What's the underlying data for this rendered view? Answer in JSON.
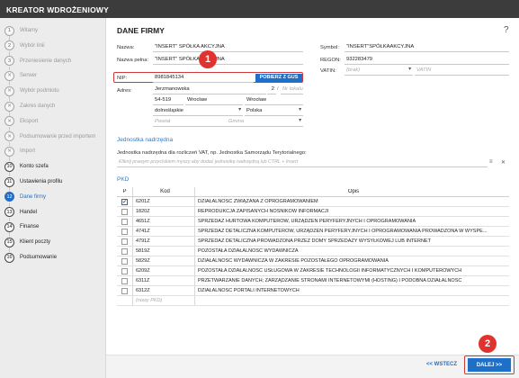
{
  "app": {
    "title": "KREATOR WDROŻENIOWY",
    "help_icon": "?"
  },
  "steps": [
    {
      "num": "1",
      "label": "Witamy",
      "state": "done"
    },
    {
      "num": "2",
      "label": "Wybór linii",
      "state": "done"
    },
    {
      "num": "3",
      "label": "Przeniesienie danych",
      "state": "done"
    },
    {
      "num": "✕",
      "label": "Serwer",
      "state": "skipped"
    },
    {
      "num": "✕",
      "label": "Wybór podmiotu",
      "state": "skipped"
    },
    {
      "num": "✕",
      "label": "Zakres danych",
      "state": "skipped"
    },
    {
      "num": "✕",
      "label": "Eksport",
      "state": "skipped"
    },
    {
      "num": "✕",
      "label": "Podsumowanie przed importem",
      "state": "skipped"
    },
    {
      "num": "✕",
      "label": "Import",
      "state": "skipped"
    },
    {
      "num": "10",
      "label": "Konto szefa",
      "state": "future"
    },
    {
      "num": "11",
      "label": "Ustawienia profilu",
      "state": "future"
    },
    {
      "num": "12",
      "label": "Dane firmy",
      "state": "active"
    },
    {
      "num": "13",
      "label": "Handel",
      "state": "future"
    },
    {
      "num": "14",
      "label": "Finanse",
      "state": "future"
    },
    {
      "num": "15",
      "label": "Klient poczty",
      "state": "future"
    },
    {
      "num": "16",
      "label": "Podsumowanie",
      "state": "future"
    }
  ],
  "form": {
    "heading": "DANE FIRMY",
    "nazwa_label": "Nazwa:",
    "nazwa_value": "\"INSERT\" SPÓŁKA AKCYJNA",
    "nazwa_pelna_label": "Nazwa pełna:",
    "nazwa_pelna_value": "\"INSERT\" SPÓŁKA AKCYJNA",
    "symbol_label": "Symbol:",
    "symbol_value": "\"INSERT\"SPÓŁKAAKCYJNA",
    "regon_label": "REGON:",
    "regon_value": "932283479",
    "vatin_label": "VATIN:",
    "vatin_prefix_placeholder": "(brak)",
    "vatin_placeholder": "VATIN",
    "nip_label": "NIP:",
    "nip_value": "8981845134",
    "gus_button": "POBIERZ Z GUS",
    "adres_label": "Adres:",
    "ulica": "Jerzmanowska",
    "nr_domu": "2",
    "nr_lokalu_placeholder": "Nr lokalu",
    "kod": "54-519",
    "miasto": "Wrocław",
    "poczta": "Wrocław",
    "wojewodztwo": "dolnośląskie",
    "kraj": "Polska",
    "powiat_placeholder": "Powiat",
    "gmina_placeholder": "Gmina"
  },
  "parent": {
    "section_title": "Jednostka nadrzędna",
    "label": "Jednostka nadrzędna dla rozliczeń VAT, np. Jednostka Samorządu Terytorialnego:",
    "placeholder": "Kliknij prawym przyciskiem myszy aby dodać jednostkę nadrzędną lub CTRL + Insert",
    "clear_icon": "✕",
    "menu_icon": "≡"
  },
  "pkd": {
    "section_title": "PKD",
    "columns": [
      "P",
      "Kod",
      "Opis"
    ],
    "rows": [
      {
        "checked": true,
        "kod": "6201Z",
        "opis": "DZIAŁALNOŚĆ ZWIĄZANA Z OPROGRAMOWANIEM"
      },
      {
        "checked": false,
        "kod": "1820Z",
        "opis": "REPRODUKCJA ZAPISANYCH NOŚNIKÓW INFORMACJI"
      },
      {
        "checked": false,
        "kod": "4651Z",
        "opis": "SPRZEDAŻ HURTOWA KOMPUTERÓW, URZĄDZEŃ PERYFERYJNYCH I OPROGRAMOWANIA"
      },
      {
        "checked": false,
        "kod": "4741Z",
        "opis": "SPRZEDAŻ DETALICZNA KOMPUTERÓW, URZĄDZEŃ PERYFERYJNYCH I OPROGRAMOWANIA PROWADZONA W WYSPE..."
      },
      {
        "checked": false,
        "kod": "4791Z",
        "opis": "SPRZEDAŻ DETALICZNA PROWADZONA PRZEZ DOMY SPRZEDAŻY WYSYŁKOWEJ LUB INTERNET"
      },
      {
        "checked": false,
        "kod": "5819Z",
        "opis": "POZOSTAŁA DZIAŁALNOŚĆ WYDAWNICZA"
      },
      {
        "checked": false,
        "kod": "5829Z",
        "opis": "DZIAŁALNOŚĆ WYDAWNICZA W ZAKRESIE POZOSTAŁEGO OPROGRAMOWANIA"
      },
      {
        "checked": false,
        "kod": "6209Z",
        "opis": "POZOSTAŁA DZIAŁALNOŚĆ USŁUGOWA W ZAKRESIE TECHNOLOGII INFORMATYCZNYCH I KOMPUTEROWYCH"
      },
      {
        "checked": false,
        "kod": "6311Z",
        "opis": "PRZETWARZANIE DANYCH; ZARZĄDZANIE STRONAMI INTERNETOWYMI (HOSTING) I PODOBNA DZIAŁALNOŚĆ"
      },
      {
        "checked": false,
        "kod": "6312Z",
        "opis": "DZIAŁALNOŚĆ PORTALI INTERNETOWYCH"
      }
    ],
    "add_placeholder": "(nowy PKD)"
  },
  "nav": {
    "back_label": "<< WSTECZ",
    "next_label": "DALEJ >>"
  },
  "annotations": {
    "badge1": "1",
    "badge2": "2"
  },
  "colors": {
    "accent": "#1e6fc8",
    "highlight": "#d13a3a",
    "badge": "#e0322e",
    "titlebar": "#3c3c3c"
  }
}
